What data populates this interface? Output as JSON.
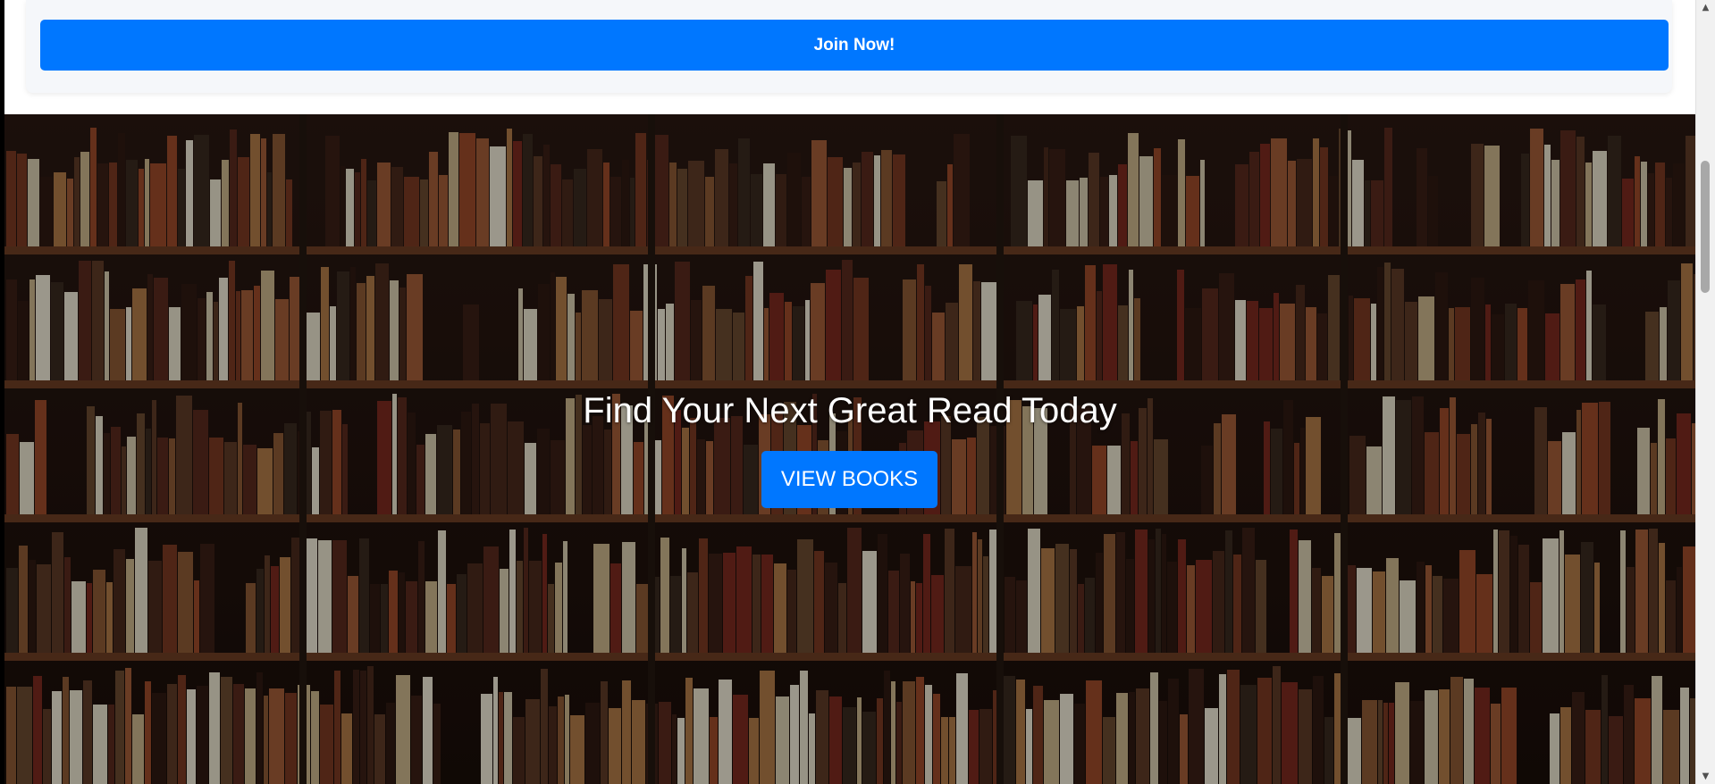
{
  "signup": {
    "join_label": "Join Now!"
  },
  "hero": {
    "title": "Find Your Next Great Read Today",
    "cta_label": "VIEW BOOKS",
    "background": "bookshelf-photo"
  },
  "colors": {
    "accent": "#0077ff",
    "hero_text": "#ffffff"
  },
  "scrollbar": {
    "up_icon": "chevron-up-icon",
    "down_icon": "chevron-down-icon"
  }
}
